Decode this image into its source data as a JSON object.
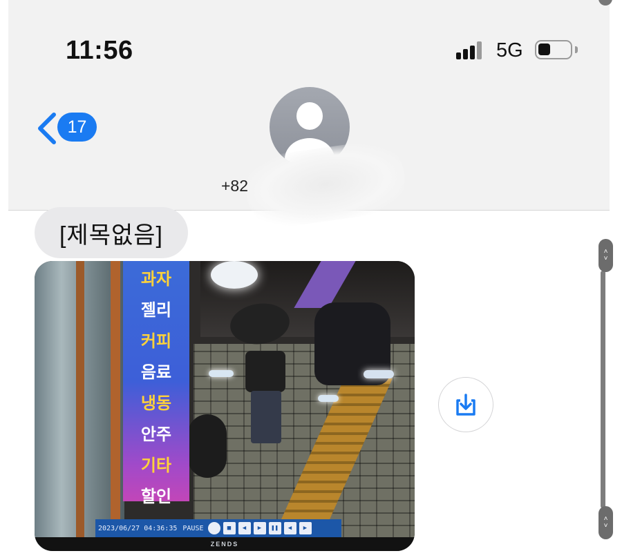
{
  "status_bar": {
    "time": "11:56",
    "network": "5G",
    "signal_bars_filled": 3,
    "signal_bars_total": 4,
    "battery_level": 0.4
  },
  "header": {
    "back_badge": "17",
    "contact_number": "+82"
  },
  "message": {
    "subject": "[제목없음]",
    "attachment": {
      "sign_words": [
        "과자",
        "젤리",
        "커피",
        "음료",
        "냉동",
        "안주",
        "기타",
        "할인"
      ],
      "sign_colors": [
        "#ffd23a",
        "#ffffff",
        "#ffd23a",
        "#ffffff",
        "#ffd23a",
        "#ffffff",
        "#ffd23a",
        "#ffffff"
      ],
      "cctv_timestamp": "2023/06/27 04:36:35",
      "cctv_status": "PAUSE",
      "cctv_brand": "ZENDS"
    }
  },
  "icons": {
    "back": "chevron-left-icon",
    "avatar": "person-icon",
    "download": "download-icon"
  },
  "colors": {
    "accent": "#1a7bf2",
    "header_bg": "#f2f2f2",
    "bubble_bg": "#e9e9eb"
  }
}
